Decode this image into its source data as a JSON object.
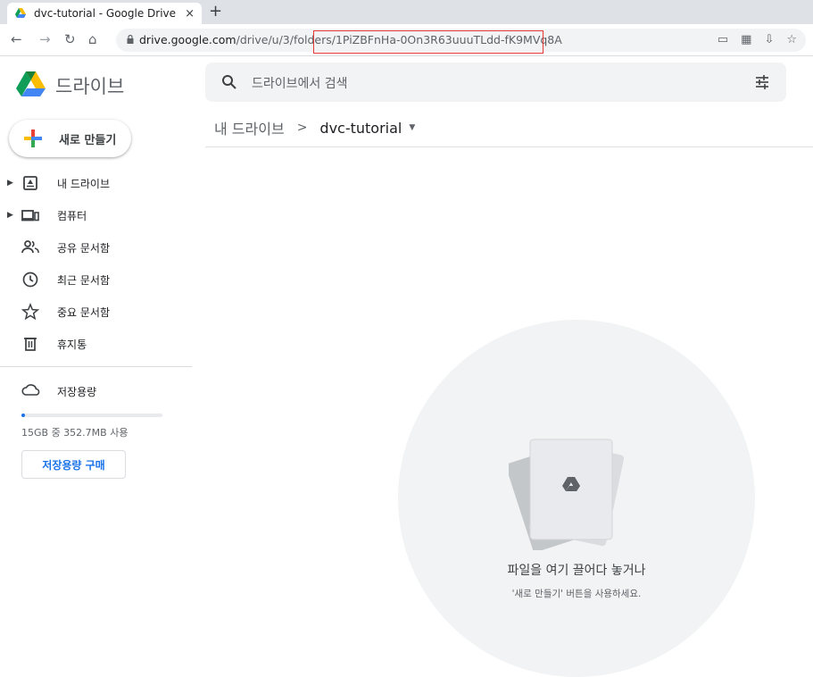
{
  "browser": {
    "tab_title": "dvc-tutorial - Google Drive",
    "new_tab": "+",
    "close": "×",
    "url_host": "drive.google.com",
    "url_path": "/drive/u/3/folders/1PiZBFnHa-0On3R63uuuTLdd-fK9MVq8A",
    "highlight_color": "#e53935"
  },
  "header": {
    "brand": "드라이브",
    "search_placeholder": "드라이브에서 검색"
  },
  "sidebar": {
    "new_button": "새로 만들기",
    "items": [
      {
        "label": "내 드라이브",
        "icon": "drive-icon",
        "expandable": true
      },
      {
        "label": "컴퓨터",
        "icon": "computer-icon",
        "expandable": true
      },
      {
        "label": "공유 문서함",
        "icon": "shared-icon",
        "expandable": false
      },
      {
        "label": "최근 문서함",
        "icon": "clock-icon",
        "expandable": false
      },
      {
        "label": "중요 문서함",
        "icon": "star-icon",
        "expandable": false
      },
      {
        "label": "휴지통",
        "icon": "trash-icon",
        "expandable": false
      }
    ],
    "storage": {
      "label": "저장용량",
      "usage_text": "15GB 중 352.7MB 사용",
      "used_fraction": 0.023,
      "buy_button": "저장용량 구매"
    }
  },
  "main": {
    "breadcrumb_root": "내 드라이브",
    "breadcrumb_sep": ">",
    "breadcrumb_current": "dvc-tutorial",
    "empty_title": "파일을 여기 끌어다 놓거나",
    "empty_subtitle": "'새로 만들기' 버튼을 사용하세요."
  },
  "colors": {
    "accent": "#1a73e8",
    "surface": "#f1f3f4"
  }
}
